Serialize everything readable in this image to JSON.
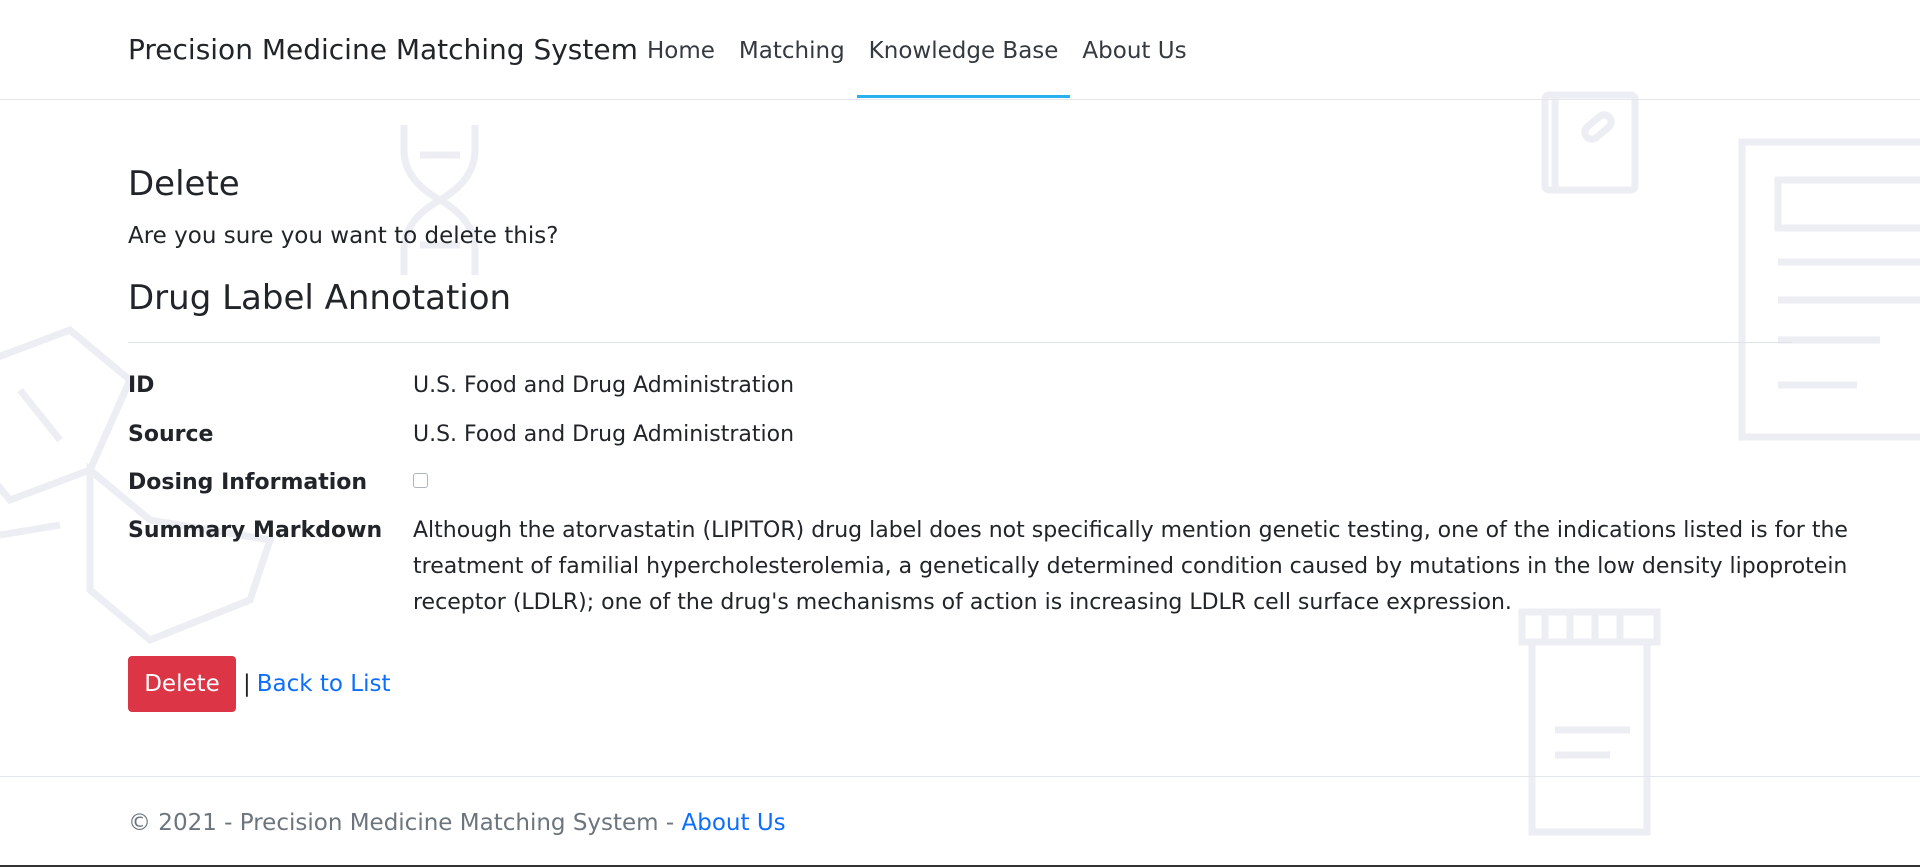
{
  "navbar": {
    "brand": "Precision Medicine Matching System",
    "items": [
      {
        "label": "Home",
        "active": false
      },
      {
        "label": "Matching",
        "active": false
      },
      {
        "label": "Knowledge Base",
        "active": true
      },
      {
        "label": "About Us",
        "active": false
      }
    ]
  },
  "page": {
    "heading": "Delete",
    "confirm_text": "Are you sure you want to delete this?",
    "section_heading": "Drug Label Annotation"
  },
  "details": [
    {
      "label": "ID",
      "value": "U.S. Food and Drug Administration"
    },
    {
      "label": "Source",
      "value": "U.S. Food and Drug Administration"
    },
    {
      "label": "Dosing Information",
      "checked": false
    },
    {
      "label": "Summary Markdown",
      "value": "Although the atorvastatin (LIPITOR) drug label does not specifically mention genetic testing, one of the indications listed is for the treatment of familial hypercholesterolemia, a genetically determined condition caused by mutations in the low density lipoprotein receptor (LDLR); one of the drug's mechanisms of action is increasing LDLR cell surface expression."
    }
  ],
  "actions": {
    "delete_label": "Delete",
    "separator": "|",
    "back_label": "Back to List"
  },
  "footer": {
    "text": "© 2021 - Precision Medicine Matching System -",
    "link_label": "About Us"
  },
  "colors": {
    "accent_underline": "#2ab0ec",
    "danger": "#dc3545",
    "link": "#0d6efd",
    "decoration": "#e9ecf3"
  }
}
